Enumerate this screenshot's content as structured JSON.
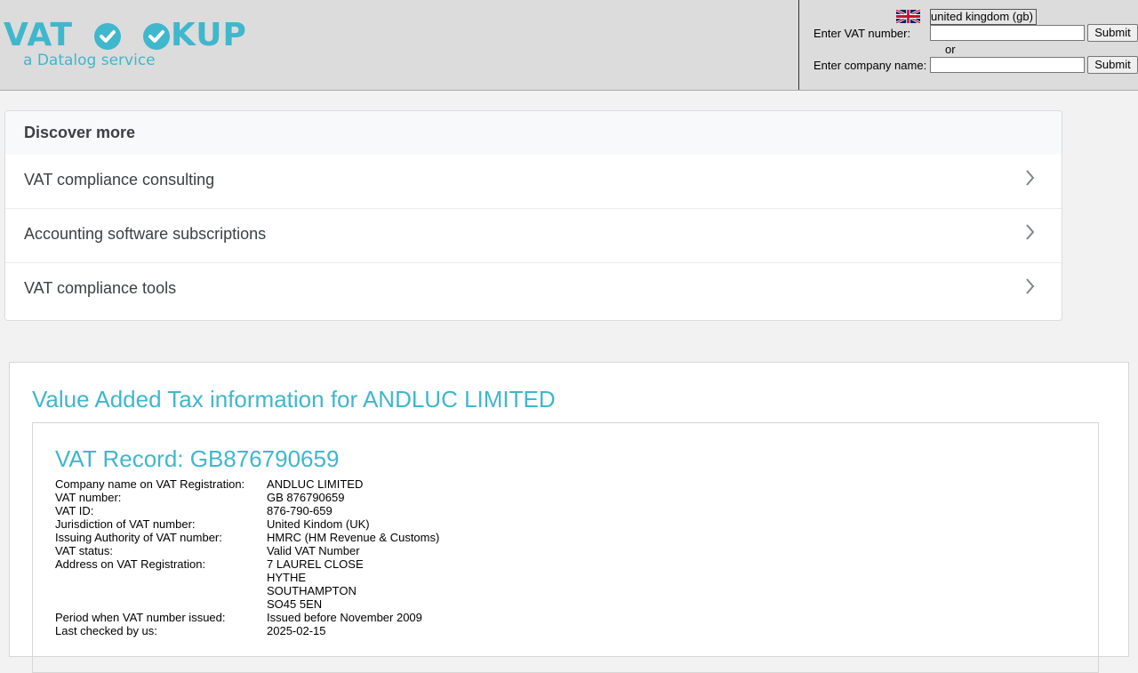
{
  "header": {
    "logo": {
      "word_left": "VAT",
      "word_right": "KUP",
      "checks": "OO",
      "tagline": "a Datalog service"
    },
    "country_select": "united kingdom (gb)",
    "vat_label": "Enter VAT number:",
    "or_label": "or",
    "company_label": "Enter company name:",
    "submit_label": "Submit",
    "vat_input_value": "",
    "company_input_value": ""
  },
  "discover": {
    "title": "Discover more",
    "items": [
      {
        "label": "VAT compliance consulting"
      },
      {
        "label": "Accounting software subscriptions"
      },
      {
        "label": "VAT compliance tools"
      }
    ]
  },
  "main": {
    "title": "Value Added Tax information for ANDLUC LIMITED",
    "record_title": "VAT Record: GB876790659",
    "fields": [
      {
        "label": "Company name on VAT Registration:",
        "value": "ANDLUC LIMITED"
      },
      {
        "label": "VAT number:",
        "value": "GB 876790659"
      },
      {
        "label": "VAT ID:",
        "value": "876-790-659"
      },
      {
        "label": "Jurisdiction of VAT number:",
        "value": "United Kindom (UK)"
      },
      {
        "label": "Issuing Authority of VAT number:",
        "value": "HMRC (HM Revenue & Customs)"
      },
      {
        "label": "VAT status:",
        "value": "Valid VAT Number"
      },
      {
        "label": "Address on VAT Registration:",
        "value": "7 LAUREL CLOSE"
      },
      {
        "label": "",
        "value": "HYTHE"
      },
      {
        "label": "",
        "value": "SOUTHAMPTON"
      },
      {
        "label": "",
        "value": "SO45 5EN"
      },
      {
        "label": "Period when VAT number issued:",
        "value": "Issued before November 2009"
      },
      {
        "label": "Last checked by us:",
        "value": "2025-02-15"
      }
    ]
  },
  "colors": {
    "brand": "#3fb7cc",
    "header_bg": "#dcdcdc",
    "page_bg": "#f2f2f2"
  },
  "icons": {
    "flag": "uk-flag-icon",
    "chevron": "chevron-right-icon",
    "check": "check-circle-icon"
  }
}
